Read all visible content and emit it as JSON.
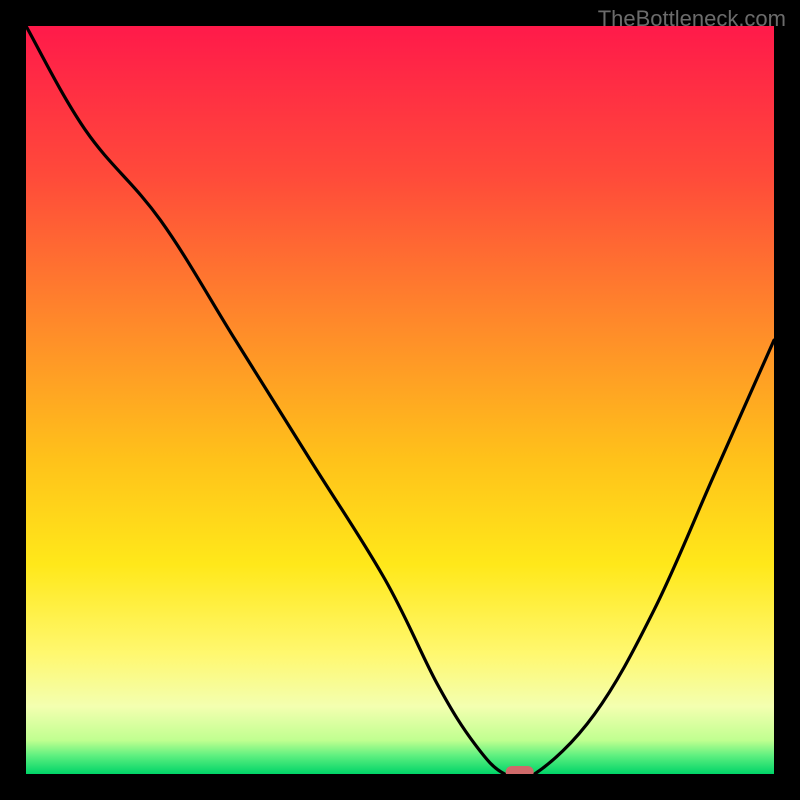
{
  "watermark": "TheBottleneck.com",
  "chart_data": {
    "type": "line",
    "title": "",
    "xlabel": "",
    "ylabel": "",
    "xlim": [
      0,
      100
    ],
    "ylim": [
      0,
      100
    ],
    "x": [
      0,
      8,
      18,
      28,
      38,
      48,
      55,
      60,
      64,
      68,
      76,
      84,
      92,
      100
    ],
    "values": [
      100,
      86,
      74,
      58,
      42,
      26,
      12,
      4,
      0,
      0,
      8,
      22,
      40,
      58
    ],
    "marker": {
      "x": 66,
      "y": 0,
      "color": "#cf6a6a"
    },
    "gradient_stops": [
      {
        "offset": 0.0,
        "color": "#ff1a4a"
      },
      {
        "offset": 0.2,
        "color": "#ff4a3a"
      },
      {
        "offset": 0.4,
        "color": "#ff8a2a"
      },
      {
        "offset": 0.58,
        "color": "#ffc21a"
      },
      {
        "offset": 0.72,
        "color": "#ffe81a"
      },
      {
        "offset": 0.84,
        "color": "#fff870"
      },
      {
        "offset": 0.91,
        "color": "#f3ffb0"
      },
      {
        "offset": 0.955,
        "color": "#c0ff90"
      },
      {
        "offset": 0.975,
        "color": "#60f080"
      },
      {
        "offset": 1.0,
        "color": "#00d468"
      }
    ]
  }
}
